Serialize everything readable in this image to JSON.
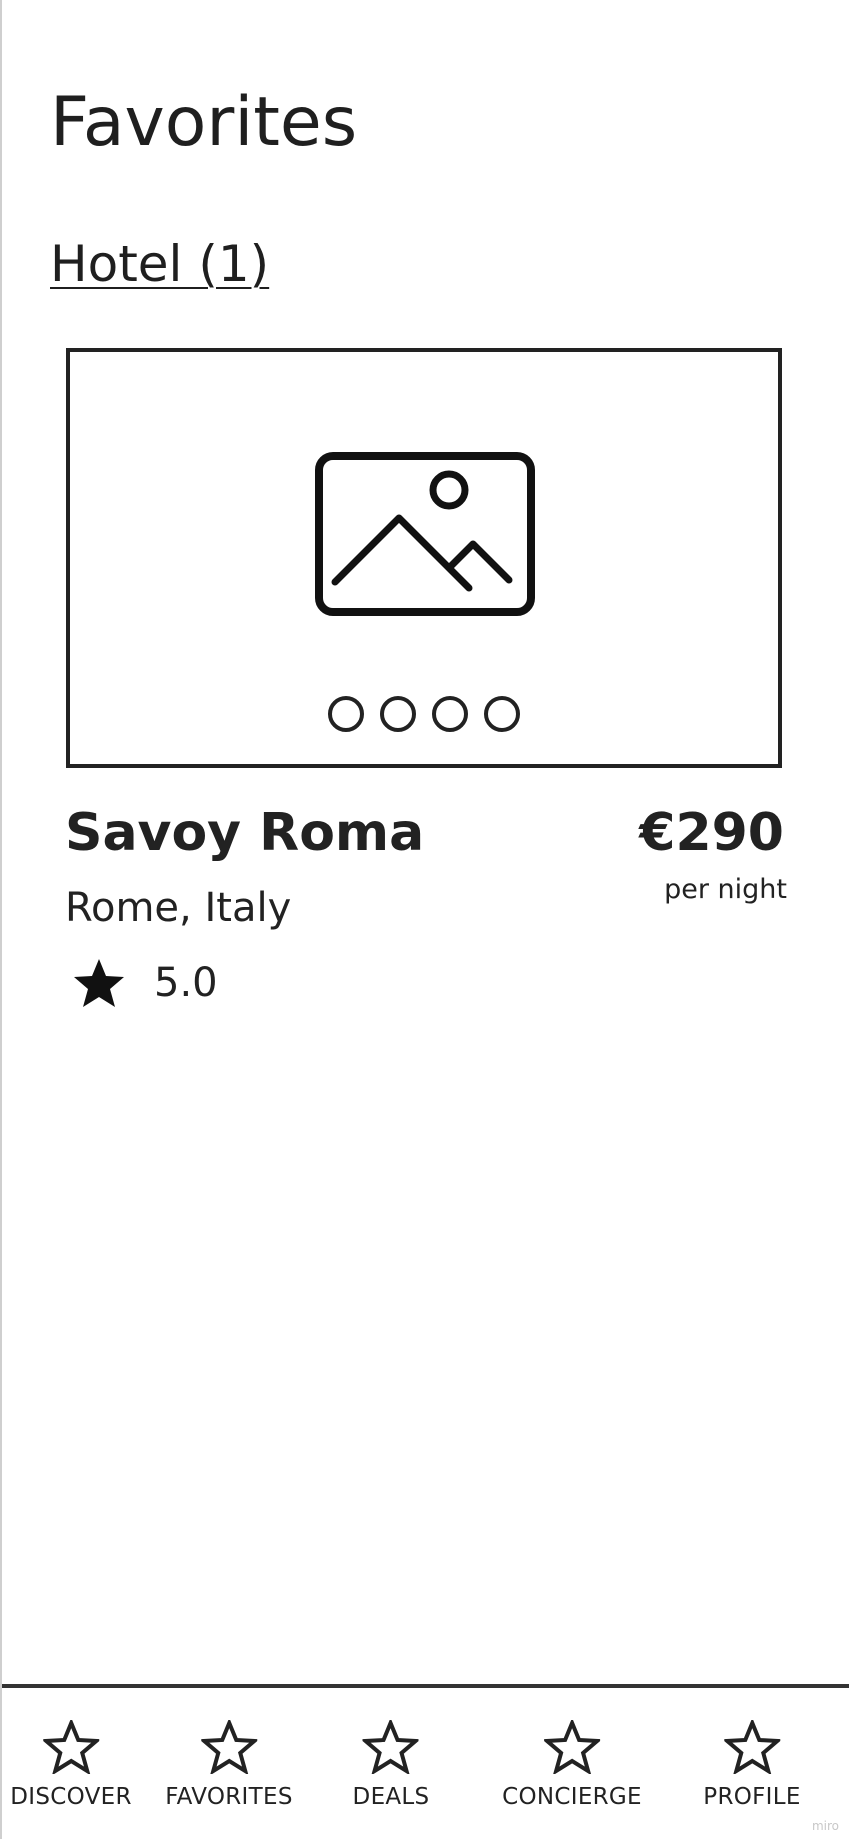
{
  "page": {
    "title": "Favorites"
  },
  "section": {
    "label": "Hotel (1)"
  },
  "hotel": {
    "name": "Savoy Roma",
    "location": "Rome, Italy",
    "price": "€290",
    "price_unit": "per night",
    "rating": "5.0",
    "carousel_dots": 4
  },
  "nav": {
    "items": [
      {
        "label": "DISCOVER",
        "icon": "star-outline-icon"
      },
      {
        "label": "FAVORITES",
        "icon": "star-outline-icon"
      },
      {
        "label": "DEALS",
        "icon": "star-outline-icon"
      },
      {
        "label": "CONCIERGE",
        "icon": "star-outline-icon"
      },
      {
        "label": "PROFILE",
        "icon": "star-outline-icon"
      }
    ]
  },
  "watermark": "miro"
}
